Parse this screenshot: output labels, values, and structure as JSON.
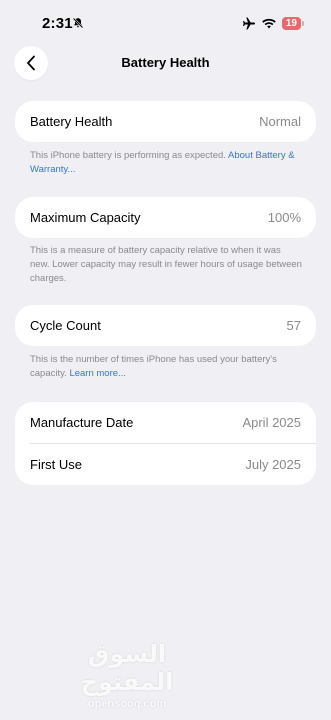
{
  "status_bar": {
    "time": "2:31",
    "battery_level": "19",
    "icons": [
      "bell-slash-icon",
      "airplane-icon",
      "wifi-icon",
      "battery-icon"
    ]
  },
  "nav": {
    "title": "Battery Health",
    "back_icon": "chevron-left-icon"
  },
  "health": {
    "label": "Battery Health",
    "value": "Normal",
    "footnote_text": "This iPhone battery is performing as expected. ",
    "footnote_link": "About Battery & Warranty..."
  },
  "capacity": {
    "label": "Maximum Capacity",
    "value": "100%",
    "footnote_text": "This is a measure of battery capacity relative to when it was new. Lower capacity may result in fewer hours of usage between charges."
  },
  "cycle": {
    "label": "Cycle Count",
    "value": "57",
    "footnote_text": "This is the number of times iPhone has used your battery's capacity. ",
    "footnote_link": "Learn more..."
  },
  "dates": {
    "manufacture_label": "Manufacture Date",
    "manufacture_value": "April 2025",
    "first_use_label": "First Use",
    "first_use_value": "July 2025"
  },
  "watermark": {
    "arabic": "السوق المفتوح",
    "latin": "opensooq.com"
  },
  "colors": {
    "background": "#efeff4",
    "card": "#ffffff",
    "link": "#3478c7",
    "secondary_text": "#8a8a8e",
    "battery_low": "#e8696c"
  }
}
